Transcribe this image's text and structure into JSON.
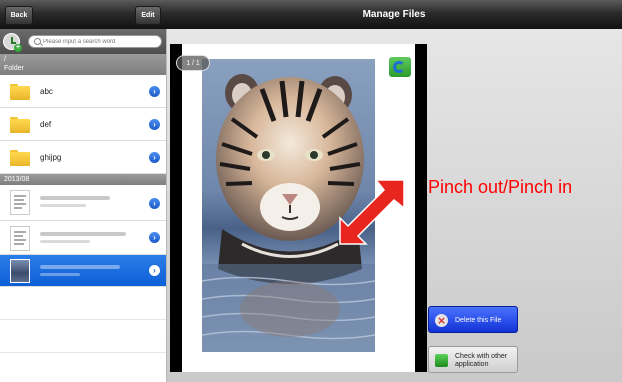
{
  "topbar": {
    "title": "Manage Files",
    "back_label": "Back",
    "edit_label": "Edit"
  },
  "search": {
    "placeholder": "Please input a search word"
  },
  "sidebar": {
    "path": "/",
    "folder_section": "Folder",
    "folders": [
      {
        "label": "abc"
      },
      {
        "label": "def"
      },
      {
        "label": "ghijpg"
      }
    ],
    "date_section": "2013/08"
  },
  "preview": {
    "page_counter": "1 / 1"
  },
  "annotation": {
    "text": "Pinch out/Pinch in",
    "color": "#ff0000"
  },
  "actions": {
    "delete_label": "Delete this File",
    "check_label": "Check with other application"
  },
  "colors": {
    "selected": "#1b6fe0",
    "accent_blue": "#1232d6"
  }
}
